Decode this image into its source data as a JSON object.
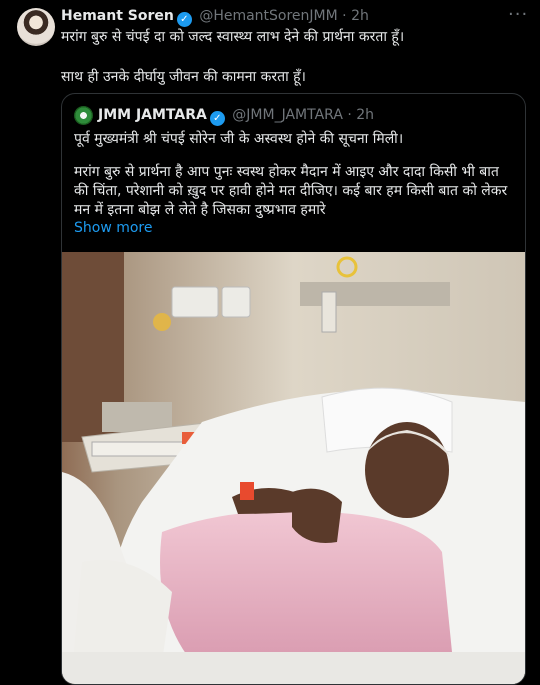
{
  "tweet": {
    "author_name": "Hemant Soren",
    "author_handle": "@HemantSorenJMM",
    "separator": "·",
    "time": "2h",
    "more_icon": "more-horizontal-icon",
    "lines": [
      "मरांग बुरु से चंपई दा को जल्द स्वास्थ्य लाभ देने की प्रार्थना करता हूँ।",
      "साथ ही उनके दीर्घायु जीवन की कामना करता हूँ।"
    ]
  },
  "quoted": {
    "author_name": "JMM JAMTARA",
    "author_handle": "@JMM_JAMTARA",
    "separator": "·",
    "time": "2h",
    "lines": [
      "पूर्व मुख्यमंत्री श्री चंपई सोरेन जी के अस्वस्थ होने की सूचना मिली।",
      "मरांग बुरु से प्रार्थना है आप पुनः स्वस्थ होकर मैदान में आइए और दादा किसी भी बात की चिंता, परेशानी को ख़ुद पर हावी होने मत दीजिए। कई बार हम किसी बात को लेकर मन में इतना बोझ ले लेते है जिसका दुष्प्रभाव हमारे"
    ],
    "show_more": "Show more"
  },
  "colors": {
    "link": "#1d9bf0",
    "verified": "#1d9bf0",
    "muted": "#71767b"
  }
}
